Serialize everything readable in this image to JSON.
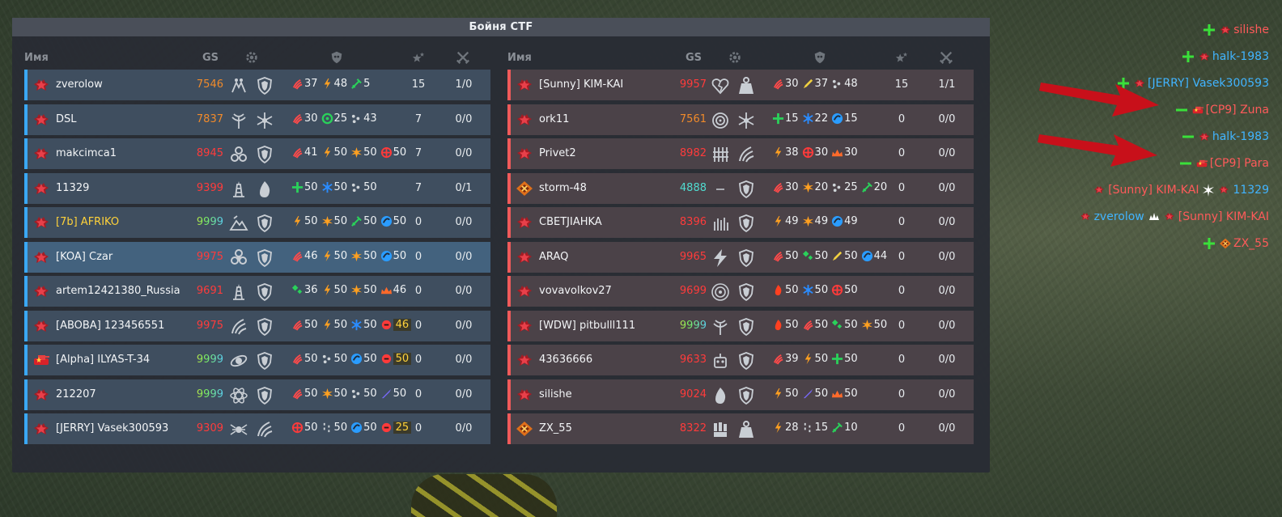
{
  "panel": {
    "title": "Бойня CTF"
  },
  "headers": {
    "name": "Имя",
    "gs": "GS"
  },
  "colors": {
    "blue_accent": "#3aa8f4",
    "red_accent": "#f05a5a",
    "gs_orange": "#f08a2a",
    "gs_red": "#ff3b3b",
    "gs_max": "#c8f050",
    "gs_teal": "#50dcd0"
  },
  "blue_team": [
    {
      "name": "zverolow",
      "gs": "7546",
      "gs_color": "orange",
      "rank": "star",
      "eq1": "paws-icon",
      "eq2": "shield-icon",
      "supplies": [
        {
          "icon": "claw-icon",
          "color": "#ff4a4a",
          "v": "37"
        },
        {
          "icon": "bolt-icon",
          "color": "#ffa020",
          "v": "48"
        },
        {
          "icon": "sword-icon",
          "color": "#2ad15a",
          "v": "5"
        }
      ],
      "score": "15",
      "kd": "1/0",
      "hl": false,
      "name_color": "#f3f5f7"
    },
    {
      "name": "DSL",
      "gs": "7837",
      "gs_color": "orange",
      "rank": "star",
      "eq1": "antenna-icon",
      "eq2": "snowflake-icon",
      "supplies": [
        {
          "icon": "claw-icon",
          "color": "#ff4a4a",
          "v": "30"
        },
        {
          "icon": "ring-icon",
          "color": "#2ad15a",
          "v": "25"
        },
        {
          "icon": "dots-icon",
          "color": "#cfd4d8",
          "v": "43"
        }
      ],
      "score": "7",
      "kd": "0/0",
      "hl": false,
      "name_color": "#f3f5f7"
    },
    {
      "name": "makcimca1",
      "gs": "8945",
      "gs_color": "red",
      "rank": "star",
      "eq1": "triskele-icon",
      "eq2": "shield-icon",
      "supplies": [
        {
          "icon": "claw-icon",
          "color": "#ff4a4a",
          "v": "41"
        },
        {
          "icon": "bolt-icon",
          "color": "#ffa020",
          "v": "50"
        },
        {
          "icon": "burst-icon",
          "color": "#ffa020",
          "v": "50"
        },
        {
          "icon": "cross-icon",
          "color": "#ff3a3a",
          "v": "50"
        }
      ],
      "score": "7",
      "kd": "0/0",
      "hl": false,
      "name_color": "#f3f5f7"
    },
    {
      "name": "11329",
      "gs": "9399",
      "gs_color": "red",
      "rank": "star",
      "eq1": "tower-icon",
      "eq2": "flame-icon",
      "supplies": [
        {
          "icon": "plus-icon",
          "color": "#2ad15a",
          "v": "50"
        },
        {
          "icon": "snowflake-icon",
          "color": "#2a8cff",
          "v": "50"
        },
        {
          "icon": "dots-icon",
          "color": "#cfd4d8",
          "v": "50"
        }
      ],
      "score": "7",
      "kd": "0/1",
      "hl": false,
      "name_color": "#f3f5f7"
    },
    {
      "name": "[7b] AFRIKO",
      "gs": "9999",
      "gs_color": "max",
      "rank": "star",
      "eq1": "hill-icon",
      "eq2": "shield-icon",
      "supplies": [
        {
          "icon": "bolt-icon",
          "color": "#ffa020",
          "v": "50"
        },
        {
          "icon": "burst-icon",
          "color": "#ffa020",
          "v": "50"
        },
        {
          "icon": "sword-icon",
          "color": "#2ad15a",
          "v": "50"
        },
        {
          "icon": "swirl-icon",
          "color": "#2a9cff",
          "v": "50"
        }
      ],
      "score": "0",
      "kd": "0/0",
      "hl": false,
      "name_color": "#ffd23a"
    },
    {
      "name": "[KOA] Czar",
      "gs": "9975",
      "gs_color": "red",
      "rank": "star",
      "eq1": "biohazard-icon",
      "eq2": "shield-icon",
      "supplies": [
        {
          "icon": "claw-icon",
          "color": "#ff4a4a",
          "v": "46"
        },
        {
          "icon": "bolt-icon",
          "color": "#ffa020",
          "v": "50"
        },
        {
          "icon": "burst-icon",
          "color": "#ffa020",
          "v": "50"
        },
        {
          "icon": "swirl-icon",
          "color": "#2a9cff",
          "v": "50"
        }
      ],
      "score": "0",
      "kd": "0/0",
      "hl": true,
      "name_color": "#f3f5f7"
    },
    {
      "name": "artem12421380_Russia",
      "gs": "9691",
      "gs_color": "red",
      "rank": "star",
      "eq1": "tower-icon",
      "eq2": "shield-icon",
      "supplies": [
        {
          "icon": "diamond-icon",
          "color": "#2ad15a",
          "v": "36"
        },
        {
          "icon": "bolt-icon",
          "color": "#ffa020",
          "v": "50"
        },
        {
          "icon": "burst-icon",
          "color": "#ffa020",
          "v": "50"
        },
        {
          "icon": "crown-icon",
          "color": "#ff6a2a",
          "v": "46"
        }
      ],
      "score": "0",
      "kd": "0/0",
      "hl": false,
      "name_color": "#f3f5f7"
    },
    {
      "name": "[ABOBA] 123456551",
      "gs": "9975",
      "gs_color": "red",
      "rank": "star",
      "eq1": "talon-icon",
      "eq2": "shield-icon",
      "supplies": [
        {
          "icon": "claw-icon",
          "color": "#ff4a4a",
          "v": "50"
        },
        {
          "icon": "bolt-icon",
          "color": "#ffa020",
          "v": "50"
        },
        {
          "icon": "snowflake-icon",
          "color": "#2a8cff",
          "v": "50"
        },
        {
          "icon": "mine-icon",
          "color": "#ff3a3a",
          "v": "46",
          "hi": true
        }
      ],
      "score": "0",
      "kd": "0/0",
      "hl": false,
      "name_color": "#f3f5f7"
    },
    {
      "name": "[Alpha] ILYAS-T-34",
      "gs": "9999",
      "gs_color": "max",
      "rank": "tank",
      "eq1": "orbit-icon",
      "eq2": "shield-icon",
      "supplies": [
        {
          "icon": "claw-icon",
          "color": "#ff4a4a",
          "v": "50"
        },
        {
          "icon": "dots-icon",
          "color": "#cfd4d8",
          "v": "50"
        },
        {
          "icon": "swirl-icon",
          "color": "#2a9cff",
          "v": "50"
        },
        {
          "icon": "mine-icon",
          "color": "#ff3a3a",
          "v": "50",
          "hi": true
        }
      ],
      "score": "0",
      "kd": "0/0",
      "hl": false,
      "name_color": "#f3f5f7"
    },
    {
      "name": "212207",
      "gs": "9999",
      "gs_color": "max",
      "rank": "star",
      "eq1": "atom-icon",
      "eq2": "shield-icon",
      "supplies": [
        {
          "icon": "claw-icon",
          "color": "#ff4a4a",
          "v": "50"
        },
        {
          "icon": "burst-icon",
          "color": "#ffa020",
          "v": "50"
        },
        {
          "icon": "dots-icon",
          "color": "#cfd4d8",
          "v": "50"
        },
        {
          "icon": "rocket-icon",
          "color": "#7a6aff",
          "v": "50"
        }
      ],
      "score": "0",
      "kd": "0/0",
      "hl": false,
      "name_color": "#f3f5f7"
    },
    {
      "name": "[JERRY] Vasek300593",
      "gs": "9309",
      "gs_color": "red",
      "rank": "star",
      "eq1": "spider-icon",
      "eq2": "talon-icon",
      "supplies": [
        {
          "icon": "cross-icon",
          "color": "#ff3a3a",
          "v": "50"
        },
        {
          "icon": "dashes-icon",
          "color": "#cfd4d8",
          "v": "50"
        },
        {
          "icon": "swirl-icon",
          "color": "#2a9cff",
          "v": "50"
        },
        {
          "icon": "mine-icon",
          "color": "#ff3a3a",
          "v": "25",
          "hi": true
        }
      ],
      "score": "0",
      "kd": "0/0",
      "hl": false,
      "name_color": "#f3f5f7"
    }
  ],
  "red_team": [
    {
      "name": "[Sunny] KIM-KAI",
      "gs": "9957",
      "gs_color": "red",
      "rank": "star",
      "eq1": "broken-heart-icon",
      "eq2": "weight-icon",
      "supplies": [
        {
          "icon": "claw-icon",
          "color": "#ff4a4a",
          "v": "30"
        },
        {
          "icon": "pen-icon",
          "color": "#f0d040",
          "v": "37"
        },
        {
          "icon": "dots-icon",
          "color": "#cfd4d8",
          "v": "48"
        }
      ],
      "score": "15",
      "kd": "1/1"
    },
    {
      "name": "ork11",
      "gs": "7561",
      "gs_color": "orange",
      "rank": "star",
      "eq1": "vortex-icon",
      "eq2": "snowflake-icon",
      "supplies": [
        {
          "icon": "plus-icon",
          "color": "#2ad15a",
          "v": "15"
        },
        {
          "icon": "snowflake-icon",
          "color": "#2a8cff",
          "v": "22"
        },
        {
          "icon": "swirl-icon",
          "color": "#2a9cff",
          "v": "15"
        }
      ],
      "score": "0",
      "kd": "0/0"
    },
    {
      "name": "Privet2",
      "gs": "8982",
      "gs_color": "red",
      "rank": "star",
      "eq1": "pillars-icon",
      "eq2": "talon-icon",
      "supplies": [
        {
          "icon": "bolt-icon",
          "color": "#ffa020",
          "v": "38"
        },
        {
          "icon": "cross-icon",
          "color": "#ff3a3a",
          "v": "30"
        },
        {
          "icon": "crown-icon",
          "color": "#ff6a2a",
          "v": "30"
        }
      ],
      "score": "0",
      "kd": "0/0"
    },
    {
      "name": "storm-48",
      "gs": "4888",
      "gs_color": "teal",
      "rank": "badge",
      "eq1": "dash-icon",
      "eq2": "shield-icon",
      "supplies": [
        {
          "icon": "claw-icon",
          "color": "#ff4a4a",
          "v": "30"
        },
        {
          "icon": "burst-icon",
          "color": "#ffa020",
          "v": "20"
        },
        {
          "icon": "dots-icon",
          "color": "#cfd4d8",
          "v": "25"
        },
        {
          "icon": "sword-icon",
          "color": "#2ad15a",
          "v": "20"
        }
      ],
      "score": "0",
      "kd": "0/0"
    },
    {
      "name": "CBETJIAHKA",
      "gs": "8396",
      "gs_color": "red",
      "rank": "star",
      "eq1": "candles-icon",
      "eq2": "shield-icon",
      "supplies": [
        {
          "icon": "bolt-icon",
          "color": "#ffa020",
          "v": "49"
        },
        {
          "icon": "burst-icon",
          "color": "#ffa020",
          "v": "49"
        },
        {
          "icon": "swirl-icon",
          "color": "#2a9cff",
          "v": "49"
        }
      ],
      "score": "0",
      "kd": "0/0"
    },
    {
      "name": "ARAQ",
      "gs": "9965",
      "gs_color": "red",
      "rank": "star",
      "eq1": "lightning-icon",
      "eq2": "shield-icon",
      "supplies": [
        {
          "icon": "claw-icon",
          "color": "#ff4a4a",
          "v": "50"
        },
        {
          "icon": "diamond-icon",
          "color": "#2ad15a",
          "v": "50"
        },
        {
          "icon": "pen-icon",
          "color": "#f0d040",
          "v": "50"
        },
        {
          "icon": "swirl-icon",
          "color": "#2a9cff",
          "v": "44"
        }
      ],
      "score": "0",
      "kd": "0/0"
    },
    {
      "name": "vovavolkov27",
      "gs": "9699",
      "gs_color": "red",
      "rank": "star",
      "eq1": "target-icon",
      "eq2": "shield-icon",
      "supplies": [
        {
          "icon": "fire-icon",
          "color": "#ff4020",
          "v": "50"
        },
        {
          "icon": "snowflake-icon",
          "color": "#2a8cff",
          "v": "50"
        },
        {
          "icon": "cross-icon",
          "color": "#ff3a3a",
          "v": "50"
        }
      ],
      "score": "0",
      "kd": "0/0"
    },
    {
      "name": "[WDW] pitbulll111",
      "gs": "9999",
      "gs_color": "max",
      "rank": "star",
      "eq1": "antenna-icon",
      "eq2": "shield-icon",
      "supplies": [
        {
          "icon": "fire-icon",
          "color": "#ff4020",
          "v": "50"
        },
        {
          "icon": "claw-icon",
          "color": "#ff4a4a",
          "v": "50"
        },
        {
          "icon": "diamond-icon",
          "color": "#2ad15a",
          "v": "50"
        },
        {
          "icon": "burst-icon",
          "color": "#ffa020",
          "v": "50"
        }
      ],
      "score": "0",
      "kd": "0/0"
    },
    {
      "name": "43636666",
      "gs": "9633",
      "gs_color": "red",
      "rank": "star",
      "eq1": "robot-icon",
      "eq2": "shield-icon",
      "supplies": [
        {
          "icon": "claw-icon",
          "color": "#ff4a4a",
          "v": "39"
        },
        {
          "icon": "bolt-icon",
          "color": "#ffa020",
          "v": "50"
        },
        {
          "icon": "plus-icon",
          "color": "#2ad15a",
          "v": "50"
        }
      ],
      "score": "0",
      "kd": "0/0"
    },
    {
      "name": "silishe",
      "gs": "9024",
      "gs_color": "red",
      "rank": "star",
      "eq1": "flame-icon",
      "eq2": "shield-icon",
      "supplies": [
        {
          "icon": "bolt-icon",
          "color": "#ffa020",
          "v": "50"
        },
        {
          "icon": "rocket-icon",
          "color": "#7a6aff",
          "v": "50"
        },
        {
          "icon": "crown-icon",
          "color": "#ff6a2a",
          "v": "50"
        }
      ],
      "score": "0",
      "kd": "0/0"
    },
    {
      "name": "ZX_55",
      "gs": "8322",
      "gs_color": "red",
      "rank": "badge",
      "eq1": "fist-icon",
      "eq2": "weight-icon",
      "supplies": [
        {
          "icon": "bolt-icon",
          "color": "#ffa020",
          "v": "28"
        },
        {
          "icon": "dashes-icon",
          "color": "#cfd4d8",
          "v": "15"
        },
        {
          "icon": "sword-icon",
          "color": "#2ad15a",
          "v": "10"
        }
      ],
      "score": "0",
      "kd": "0/0"
    }
  ],
  "kill_feed": [
    {
      "icon": "plus-icon",
      "icon_color": "#3ae03a",
      "rank": "star",
      "name": "silishe",
      "team": "red"
    },
    {
      "icon": "plus-icon",
      "icon_color": "#3ae03a",
      "rank": "star",
      "name": "halk-1983",
      "team": "blue"
    },
    {
      "icon": "plus-icon",
      "icon_color": "#3ae03a",
      "rank": "star",
      "name": "[JERRY] Vasek300593",
      "team": "blue"
    },
    {
      "icon": "minus-icon",
      "icon_color": "#3ae03a",
      "rank": "tank",
      "name": "[CP9] Zuna",
      "team": "red"
    },
    {
      "icon": "minus-icon",
      "icon_color": "#3ae03a",
      "rank": "star",
      "name": "halk-1983",
      "team": "blue"
    },
    {
      "icon": "minus-icon",
      "icon_color": "#3ae03a",
      "rank": "tank",
      "name": "[CP9] Para",
      "team": "red"
    },
    {
      "kill": true,
      "a_name": "[Sunny] KIM-KAI",
      "a_team": "red",
      "weapon": "burst-white-icon",
      "v_name": "11329",
      "v_team": "blue"
    },
    {
      "kill": true,
      "a_name": "zverolow",
      "a_team": "blue",
      "weapon": "splash-white-icon",
      "v_name": "[Sunny] KIM-KAI",
      "v_team": "red"
    },
    {
      "icon": "plus-icon",
      "icon_color": "#3ae03a",
      "rank": "badge",
      "name": "ZX_55",
      "team": "red"
    }
  ]
}
